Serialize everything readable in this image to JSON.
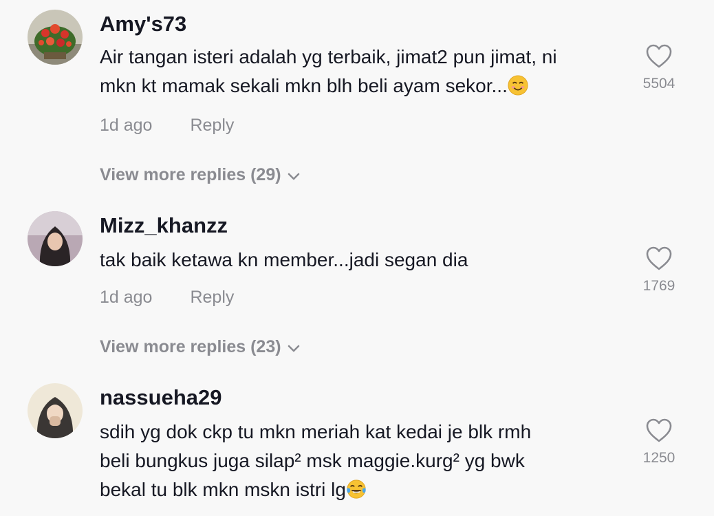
{
  "comments": [
    {
      "username": "Amy's73",
      "lines": [
        "Air tangan isteri adalah yg terbaik, jimat2 pun jimat, ni",
        "mkn kt mamak sekali mkn blh beli ayam sekor..."
      ],
      "emoji": "smiling-face-emoji",
      "time": "1d ago",
      "reply_label": "Reply",
      "likes": "5504",
      "view_more": "View more replies (29)"
    },
    {
      "username": "Mizz_khanzz",
      "lines": [
        "tak baik ketawa kn member...jadi segan dia"
      ],
      "time": "1d ago",
      "reply_label": "Reply",
      "likes": "1769",
      "view_more": "View more replies (23)"
    },
    {
      "username": "nassueha29",
      "lines": [
        "sdih yg dok ckp tu mkn meriah kat kedai je blk rmh",
        "beli bungkus juga silap² msk maggie.kurg² yg bwk",
        "bekal tu blk mkn mskn istri lg"
      ],
      "emoji": "tears-of-joy-emoji",
      "likes": "1250"
    }
  ],
  "colors": {
    "background": "#f8f8f8",
    "text": "#161823",
    "secondary": "#8a8b91"
  }
}
